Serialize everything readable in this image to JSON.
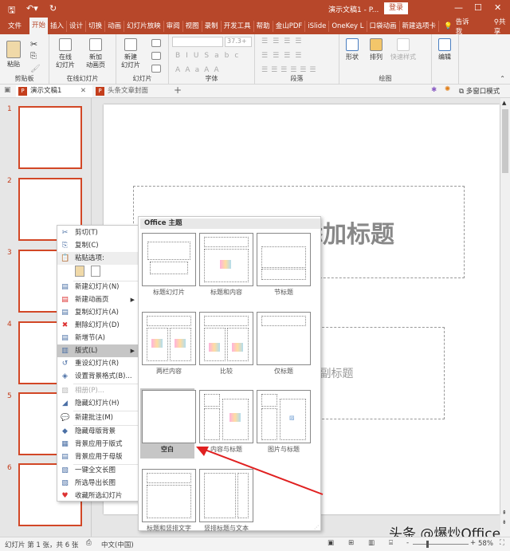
{
  "titlebar": {
    "doc_title": "演示文稿1 - P...",
    "login": "登录",
    "quick_access": [
      "save-icon",
      "undo-icon",
      "redo-icon"
    ],
    "colors": {
      "accent": "#b7472a"
    }
  },
  "ribbon_tabs": [
    "文件",
    "开始",
    "插入",
    "设计",
    "切换",
    "动画",
    "幻灯片放映",
    "审阅",
    "视图",
    "录制",
    "开发工具",
    "帮助",
    "金山PDF",
    "iSlide",
    "OneKey L",
    "口袋动画",
    "新建选项卡"
  ],
  "ribbon_active_tab": "开始",
  "tell_me": "告诉我",
  "share": "共享",
  "ribbon": {
    "clipboard": {
      "label": "剪贴板",
      "paste": "粘贴"
    },
    "online": {
      "label": "在线幻灯片",
      "btn1": "在线\n幻灯片",
      "btn2": "新加\n动画页"
    },
    "slides": {
      "label": "幻灯片",
      "new_slide": "新建\n幻灯片"
    },
    "font": {
      "label": "字体",
      "size": "37.3+"
    },
    "paragraph": {
      "label": "段落"
    },
    "drawing": {
      "label": "绘图",
      "shapes": "形状",
      "arrange": "排列",
      "quick_styles": "快速样式"
    },
    "editing": {
      "label": "编辑"
    }
  },
  "doc_tabs": [
    {
      "label": "演示文稿1",
      "active": true
    },
    {
      "label": "头条文章封面",
      "active": false
    }
  ],
  "multi_window": "多窗口模式",
  "slide_numbers": [
    "1",
    "2",
    "3",
    "4",
    "5",
    "6"
  ],
  "slide": {
    "title_placeholder": "单击此处添加标题",
    "subtitle_placeholder": "单击此处添加副标题"
  },
  "context_menu": [
    {
      "label": "剪切(T)",
      "icon": "scissors-icon"
    },
    {
      "label": "复制(C)",
      "icon": "copy-icon"
    },
    {
      "label": "粘贴选项:",
      "icon": "paste-icon"
    },
    {
      "label": "新建幻灯片(N)",
      "icon": "new-slide-icon"
    },
    {
      "label": "新建动画页",
      "icon": "new-animation-icon",
      "submenu": true
    },
    {
      "label": "复制幻灯片(A)",
      "icon": "duplicate-slide-icon"
    },
    {
      "label": "删除幻灯片(D)",
      "icon": "delete-slide-icon"
    },
    {
      "label": "新增节(A)",
      "icon": "add-section-icon"
    },
    {
      "label": "版式(L)",
      "icon": "layout-icon",
      "submenu": true,
      "highlighted": true
    },
    {
      "label": "重设幻灯片(R)",
      "icon": "reset-slide-icon"
    },
    {
      "label": "设置背景格式(B)...",
      "icon": "format-background-icon"
    },
    {
      "label": "相册(P)...",
      "icon": "photo-album-icon",
      "disabled": true
    },
    {
      "label": "隐藏幻灯片(H)",
      "icon": "hide-slide-icon"
    },
    {
      "label": "新建批注(M)",
      "icon": "new-comment-icon"
    },
    {
      "label": "隐藏母版背景",
      "icon": "hide-master-bg-icon"
    },
    {
      "label": "背景应用于版式",
      "icon": "apply-bg-layout-icon"
    },
    {
      "label": "背景应用于母版",
      "icon": "apply-bg-master-icon"
    },
    {
      "label": "一键全文长图",
      "icon": "long-image-icon"
    },
    {
      "label": "所选导出长图",
      "icon": "export-long-image-icon"
    },
    {
      "label": "收藏所选幻灯片",
      "icon": "favorite-icon"
    }
  ],
  "layout_menu": {
    "header": "Office 主题",
    "layouts": [
      "标题幻灯片",
      "标题和内容",
      "节标题",
      "两栏内容",
      "比较",
      "仅标题",
      "空白",
      "内容与标题",
      "图片与标题",
      "标题和竖排文字",
      "竖排标题与文本"
    ],
    "selected": "空白"
  },
  "status": {
    "slide_info": "幻灯片 第 1 张，共 6 张",
    "language": "中文(中国)",
    "zoom": "58%"
  },
  "watermark": "头条 @爆炒Office"
}
